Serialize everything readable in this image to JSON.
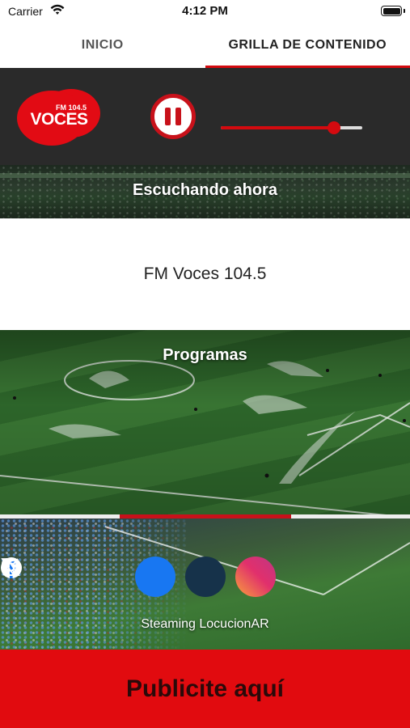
{
  "status_bar": {
    "carrier": "Carrier",
    "time": "4:12 PM"
  },
  "tabs": [
    {
      "label": "INICIO",
      "active": false
    },
    {
      "label": "GRILLA DE CONTENIDO",
      "active": true
    }
  ],
  "player": {
    "logo_text": "VOCES",
    "logo_freq": "FM 104.5",
    "state": "playing",
    "volume": 0.8,
    "accent_color": "#d40a0f",
    "background_color": "#2a2a2a"
  },
  "listening": {
    "title": "Escuchando ahora",
    "station": "FM Voces 104.5"
  },
  "programs": {
    "title": "Programas",
    "page_index": 1,
    "page_count": 3
  },
  "social": {
    "icons": [
      "facebook-icon",
      "x-icon",
      "instagram-icon"
    ],
    "credit": "Steaming LocucionAR"
  },
  "ad": {
    "label": "Publicite aquí"
  }
}
